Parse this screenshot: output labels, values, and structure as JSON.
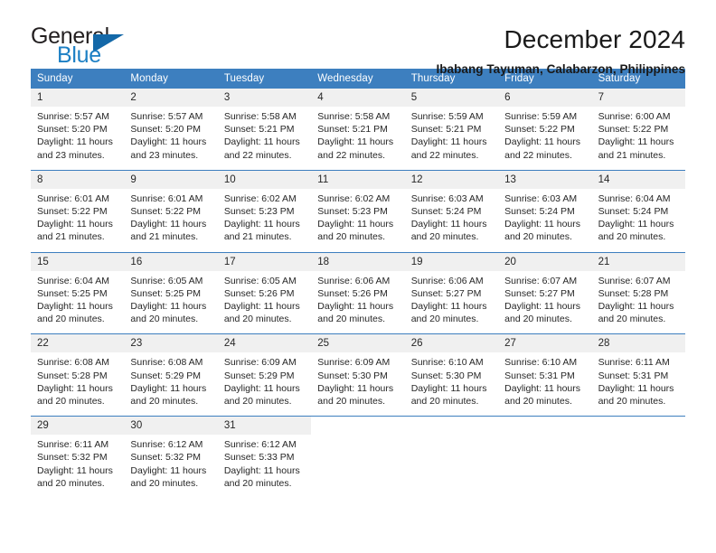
{
  "logo": {
    "word1": "General",
    "word2": "Blue",
    "icon": "triangle-logo-mark",
    "accent_color": "#1368a8"
  },
  "header": {
    "title": "December 2024",
    "subtitle": "Ibabang Tayuman, Calabarzon, Philippines"
  },
  "theme": {
    "header_blue": "#3d7fbf",
    "day_band_gray": "#f0f0f0",
    "text": "#262626"
  },
  "calendar": {
    "weekday_headers": [
      "Sunday",
      "Monday",
      "Tuesday",
      "Wednesday",
      "Thursday",
      "Friday",
      "Saturday"
    ],
    "weeks": [
      [
        {
          "day": "1",
          "sunrise": "Sunrise: 5:57 AM",
          "sunset": "Sunset: 5:20 PM",
          "daylight1": "Daylight: 11 hours",
          "daylight2": "and 23 minutes."
        },
        {
          "day": "2",
          "sunrise": "Sunrise: 5:57 AM",
          "sunset": "Sunset: 5:20 PM",
          "daylight1": "Daylight: 11 hours",
          "daylight2": "and 23 minutes."
        },
        {
          "day": "3",
          "sunrise": "Sunrise: 5:58 AM",
          "sunset": "Sunset: 5:21 PM",
          "daylight1": "Daylight: 11 hours",
          "daylight2": "and 22 minutes."
        },
        {
          "day": "4",
          "sunrise": "Sunrise: 5:58 AM",
          "sunset": "Sunset: 5:21 PM",
          "daylight1": "Daylight: 11 hours",
          "daylight2": "and 22 minutes."
        },
        {
          "day": "5",
          "sunrise": "Sunrise: 5:59 AM",
          "sunset": "Sunset: 5:21 PM",
          "daylight1": "Daylight: 11 hours",
          "daylight2": "and 22 minutes."
        },
        {
          "day": "6",
          "sunrise": "Sunrise: 5:59 AM",
          "sunset": "Sunset: 5:22 PM",
          "daylight1": "Daylight: 11 hours",
          "daylight2": "and 22 minutes."
        },
        {
          "day": "7",
          "sunrise": "Sunrise: 6:00 AM",
          "sunset": "Sunset: 5:22 PM",
          "daylight1": "Daylight: 11 hours",
          "daylight2": "and 21 minutes."
        }
      ],
      [
        {
          "day": "8",
          "sunrise": "Sunrise: 6:01 AM",
          "sunset": "Sunset: 5:22 PM",
          "daylight1": "Daylight: 11 hours",
          "daylight2": "and 21 minutes."
        },
        {
          "day": "9",
          "sunrise": "Sunrise: 6:01 AM",
          "sunset": "Sunset: 5:22 PM",
          "daylight1": "Daylight: 11 hours",
          "daylight2": "and 21 minutes."
        },
        {
          "day": "10",
          "sunrise": "Sunrise: 6:02 AM",
          "sunset": "Sunset: 5:23 PM",
          "daylight1": "Daylight: 11 hours",
          "daylight2": "and 21 minutes."
        },
        {
          "day": "11",
          "sunrise": "Sunrise: 6:02 AM",
          "sunset": "Sunset: 5:23 PM",
          "daylight1": "Daylight: 11 hours",
          "daylight2": "and 20 minutes."
        },
        {
          "day": "12",
          "sunrise": "Sunrise: 6:03 AM",
          "sunset": "Sunset: 5:24 PM",
          "daylight1": "Daylight: 11 hours",
          "daylight2": "and 20 minutes."
        },
        {
          "day": "13",
          "sunrise": "Sunrise: 6:03 AM",
          "sunset": "Sunset: 5:24 PM",
          "daylight1": "Daylight: 11 hours",
          "daylight2": "and 20 minutes."
        },
        {
          "day": "14",
          "sunrise": "Sunrise: 6:04 AM",
          "sunset": "Sunset: 5:24 PM",
          "daylight1": "Daylight: 11 hours",
          "daylight2": "and 20 minutes."
        }
      ],
      [
        {
          "day": "15",
          "sunrise": "Sunrise: 6:04 AM",
          "sunset": "Sunset: 5:25 PM",
          "daylight1": "Daylight: 11 hours",
          "daylight2": "and 20 minutes."
        },
        {
          "day": "16",
          "sunrise": "Sunrise: 6:05 AM",
          "sunset": "Sunset: 5:25 PM",
          "daylight1": "Daylight: 11 hours",
          "daylight2": "and 20 minutes."
        },
        {
          "day": "17",
          "sunrise": "Sunrise: 6:05 AM",
          "sunset": "Sunset: 5:26 PM",
          "daylight1": "Daylight: 11 hours",
          "daylight2": "and 20 minutes."
        },
        {
          "day": "18",
          "sunrise": "Sunrise: 6:06 AM",
          "sunset": "Sunset: 5:26 PM",
          "daylight1": "Daylight: 11 hours",
          "daylight2": "and 20 minutes."
        },
        {
          "day": "19",
          "sunrise": "Sunrise: 6:06 AM",
          "sunset": "Sunset: 5:27 PM",
          "daylight1": "Daylight: 11 hours",
          "daylight2": "and 20 minutes."
        },
        {
          "day": "20",
          "sunrise": "Sunrise: 6:07 AM",
          "sunset": "Sunset: 5:27 PM",
          "daylight1": "Daylight: 11 hours",
          "daylight2": "and 20 minutes."
        },
        {
          "day": "21",
          "sunrise": "Sunrise: 6:07 AM",
          "sunset": "Sunset: 5:28 PM",
          "daylight1": "Daylight: 11 hours",
          "daylight2": "and 20 minutes."
        }
      ],
      [
        {
          "day": "22",
          "sunrise": "Sunrise: 6:08 AM",
          "sunset": "Sunset: 5:28 PM",
          "daylight1": "Daylight: 11 hours",
          "daylight2": "and 20 minutes."
        },
        {
          "day": "23",
          "sunrise": "Sunrise: 6:08 AM",
          "sunset": "Sunset: 5:29 PM",
          "daylight1": "Daylight: 11 hours",
          "daylight2": "and 20 minutes."
        },
        {
          "day": "24",
          "sunrise": "Sunrise: 6:09 AM",
          "sunset": "Sunset: 5:29 PM",
          "daylight1": "Daylight: 11 hours",
          "daylight2": "and 20 minutes."
        },
        {
          "day": "25",
          "sunrise": "Sunrise: 6:09 AM",
          "sunset": "Sunset: 5:30 PM",
          "daylight1": "Daylight: 11 hours",
          "daylight2": "and 20 minutes."
        },
        {
          "day": "26",
          "sunrise": "Sunrise: 6:10 AM",
          "sunset": "Sunset: 5:30 PM",
          "daylight1": "Daylight: 11 hours",
          "daylight2": "and 20 minutes."
        },
        {
          "day": "27",
          "sunrise": "Sunrise: 6:10 AM",
          "sunset": "Sunset: 5:31 PM",
          "daylight1": "Daylight: 11 hours",
          "daylight2": "and 20 minutes."
        },
        {
          "day": "28",
          "sunrise": "Sunrise: 6:11 AM",
          "sunset": "Sunset: 5:31 PM",
          "daylight1": "Daylight: 11 hours",
          "daylight2": "and 20 minutes."
        }
      ],
      [
        {
          "day": "29",
          "sunrise": "Sunrise: 6:11 AM",
          "sunset": "Sunset: 5:32 PM",
          "daylight1": "Daylight: 11 hours",
          "daylight2": "and 20 minutes."
        },
        {
          "day": "30",
          "sunrise": "Sunrise: 6:12 AM",
          "sunset": "Sunset: 5:32 PM",
          "daylight1": "Daylight: 11 hours",
          "daylight2": "and 20 minutes."
        },
        {
          "day": "31",
          "sunrise": "Sunrise: 6:12 AM",
          "sunset": "Sunset: 5:33 PM",
          "daylight1": "Daylight: 11 hours",
          "daylight2": "and 20 minutes."
        },
        {
          "day": "",
          "sunrise": "",
          "sunset": "",
          "daylight1": "",
          "daylight2": ""
        },
        {
          "day": "",
          "sunrise": "",
          "sunset": "",
          "daylight1": "",
          "daylight2": ""
        },
        {
          "day": "",
          "sunrise": "",
          "sunset": "",
          "daylight1": "",
          "daylight2": ""
        },
        {
          "day": "",
          "sunrise": "",
          "sunset": "",
          "daylight1": "",
          "daylight2": ""
        }
      ]
    ]
  }
}
